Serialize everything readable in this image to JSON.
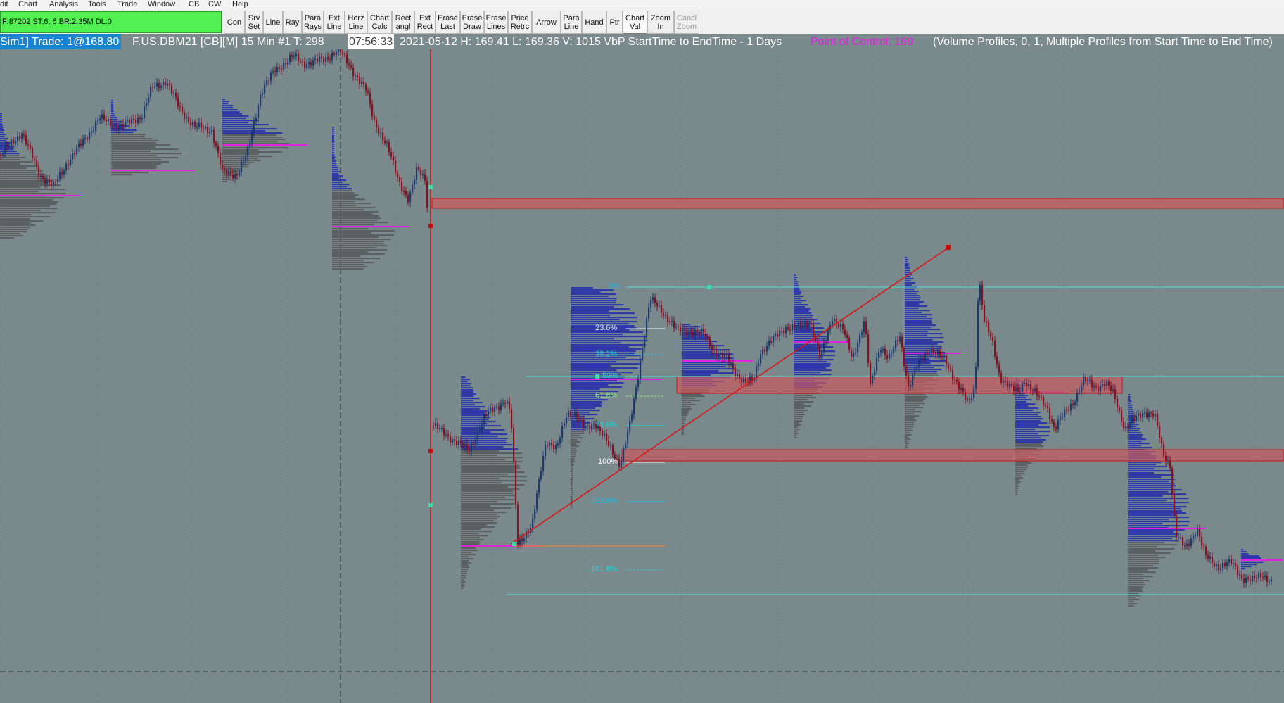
{
  "menu": [
    "dit",
    "Chart",
    "Analysis",
    "Tools",
    "Trade",
    "Window",
    "CB",
    "CW",
    "Help"
  ],
  "status": "F:87202  ST:6, 6  BR:2.35M  DL:0",
  "toolbar": [
    {
      "label": "Con"
    },
    {
      "label": "Srv\nSet"
    },
    {
      "label": "Line"
    },
    {
      "label": "Ray"
    },
    {
      "label": "Para\nRays"
    },
    {
      "label": "Ext\nLine"
    },
    {
      "label": "Horz\nLine"
    },
    {
      "label": "Chart\nCalc"
    },
    {
      "label": "Rect\nangl"
    },
    {
      "label": "Ext\nRect"
    },
    {
      "label": "Erase\nLast"
    },
    {
      "label": "Erase\nDraw"
    },
    {
      "label": "Erase\nLines"
    },
    {
      "label": "Price\nRetrc"
    },
    {
      "label": "Arrow"
    },
    {
      "label": "Para\nLine"
    },
    {
      "label": "Hand"
    },
    {
      "label": "Ptr"
    },
    {
      "label": "Chart\nVal"
    },
    {
      "label": "Zoom\nIn"
    },
    {
      "label": "Cancl\nZoom"
    }
  ],
  "title_bar": {
    "account": "Sim1]  Trade: 1@168.80",
    "symbol": "F.US.DBM21 [CB][M]  15 Min   #1 T: 298",
    "time": "07:56:33",
    "quote": "2021-05-12 H: 169.41  L: 169.36  V: 1015  VbP StartTime to EndTime - 1 Days",
    "poc": "Point of Control: 169",
    "study": "(Volume Profiles, 0, 1, Multiple Profiles from Start Time to End Time)"
  },
  "fib_levels": [
    {
      "label": "0%",
      "color": "#19b8e6"
    },
    {
      "label": "23.6%",
      "color": "#e8f7ff"
    },
    {
      "label": "38.2%",
      "color": "#19c8e6"
    },
    {
      "label": "50%",
      "color": "#19d8c8"
    },
    {
      "label": "61.8%",
      "color": "#8ee87a"
    },
    {
      "label": "78.6%",
      "color": "#19d8d8"
    },
    {
      "label": "100%",
      "color": "#ffffff"
    },
    {
      "label": "123.6%",
      "color": "#19b8e6"
    },
    {
      "label": "161.8%",
      "color": "#19d8d8"
    }
  ],
  "colors": {
    "background": "#7a8a8c",
    "candle_up": "#1d3a6e",
    "candle_down": "#8a0f1f",
    "poc_line": "#e21fe2",
    "fib_line": "#48e0d4",
    "zone_fill": "#c85a5e",
    "trend_line": "#d81818"
  }
}
